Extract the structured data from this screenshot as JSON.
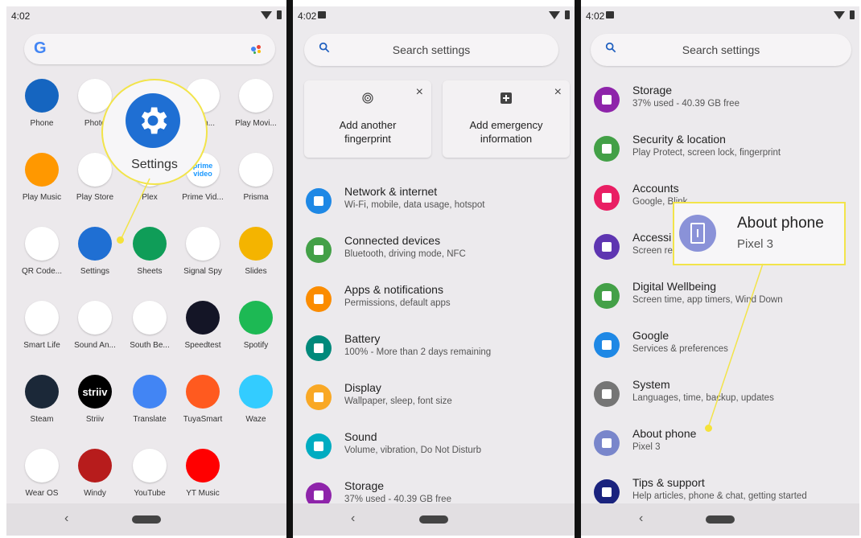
{
  "status": {
    "time": "4:02"
  },
  "launcher": {
    "apps": [
      {
        "label": "Phone",
        "color": "#1565c0"
      },
      {
        "label": "Photo",
        "color": "#ffffff"
      },
      {
        "label": "",
        "color": "#ffffff"
      },
      {
        "label": "Gam...",
        "color": "#ffffff"
      },
      {
        "label": "Play Movi...",
        "color": "#ffffff"
      },
      {
        "label": "Play Music",
        "color": "#ff9800"
      },
      {
        "label": "Play Store",
        "color": "#ffffff"
      },
      {
        "label": "Plex",
        "color": "#ffffff"
      },
      {
        "label": "Prime Vid...",
        "color": "#ffffff"
      },
      {
        "label": "Prisma",
        "color": "#ffffff"
      },
      {
        "label": "QR Code...",
        "color": "#ffffff"
      },
      {
        "label": "Settings",
        "color": "#1f6fd3"
      },
      {
        "label": "Sheets",
        "color": "#0f9d58"
      },
      {
        "label": "Signal Spy",
        "color": "#ffffff"
      },
      {
        "label": "Slides",
        "color": "#f4b400"
      },
      {
        "label": "Smart Life",
        "color": "#ffffff"
      },
      {
        "label": "Sound An...",
        "color": "#ffffff"
      },
      {
        "label": "South Be...",
        "color": "#ffffff"
      },
      {
        "label": "Speedtest",
        "color": "#141526"
      },
      {
        "label": "Spotify",
        "color": "#1db954"
      },
      {
        "label": "Steam",
        "color": "#1b2838"
      },
      {
        "label": "Striiv",
        "color": "#000000"
      },
      {
        "label": "Translate",
        "color": "#4285f4"
      },
      {
        "label": "TuyaSmart",
        "color": "#ff5a1f"
      },
      {
        "label": "Waze",
        "color": "#33ccff"
      },
      {
        "label": "Wear OS",
        "color": "#ffffff"
      },
      {
        "label": "Windy",
        "color": "#b71c1c"
      },
      {
        "label": "YouTube",
        "color": "#ffffff"
      },
      {
        "label": "YT Music",
        "color": "#ff0000"
      }
    ],
    "app_text": {
      "striiv": "striiv",
      "prime": "prime video"
    },
    "callout_label": "Settings"
  },
  "settings": {
    "search_placeholder": "Search settings",
    "suggestions": [
      {
        "title_line1": "Add another",
        "title_line2": "fingerprint",
        "icon": "fingerprint-icon"
      },
      {
        "title_line1": "Add emergency",
        "title_line2": "information",
        "icon": "plus-icon"
      }
    ],
    "rows": [
      {
        "title": "Network & internet",
        "subtitle": "Wi-Fi, mobile, data usage, hotspot",
        "color": "#1e88e5",
        "icon": "wifi-icon"
      },
      {
        "title": "Connected devices",
        "subtitle": "Bluetooth, driving mode, NFC",
        "color": "#43a047",
        "icon": "devices-icon"
      },
      {
        "title": "Apps & notifications",
        "subtitle": "Permissions, default apps",
        "color": "#fb8c00",
        "icon": "apps-icon"
      },
      {
        "title": "Battery",
        "subtitle": "100% - More than 2 days remaining",
        "color": "#00897b",
        "icon": "battery-icon"
      },
      {
        "title": "Display",
        "subtitle": "Wallpaper, sleep, font size",
        "color": "#f9a825",
        "icon": "display-icon"
      },
      {
        "title": "Sound",
        "subtitle": "Volume, vibration, Do Not Disturb",
        "color": "#00acc1",
        "icon": "sound-icon"
      },
      {
        "title": "Storage",
        "subtitle": "37% used - 40.39 GB free",
        "color": "#8e24aa",
        "icon": "storage-icon"
      }
    ]
  },
  "settings_scrolled": {
    "rows": [
      {
        "title": "Storage",
        "subtitle": "37% used - 40.39 GB free",
        "color": "#8e24aa",
        "icon": "storage-icon"
      },
      {
        "title": "Security & location",
        "subtitle": "Play Protect, screen lock, fingerprint",
        "color": "#43a047",
        "icon": "lock-icon"
      },
      {
        "title": "Accounts",
        "subtitle": "Google, Blink",
        "color": "#e91e63",
        "icon": "accounts-icon"
      },
      {
        "title": "Accessi",
        "subtitle": "Screen re",
        "color": "#5e35b1",
        "icon": "accessibility-icon"
      },
      {
        "title": "Digital Wellbeing",
        "subtitle": "Screen time, app timers, Wind Down",
        "color": "#43a047",
        "icon": "wellbeing-icon"
      },
      {
        "title": "Google",
        "subtitle": "Services & preferences",
        "color": "#1e88e5",
        "icon": "google-icon"
      },
      {
        "title": "System",
        "subtitle": "Languages, time, backup, updates",
        "color": "#757575",
        "icon": "info-icon"
      },
      {
        "title": "About phone",
        "subtitle": "Pixel 3",
        "color": "#7986cb",
        "icon": "phone-icon"
      },
      {
        "title": "Tips & support",
        "subtitle": "Help articles, phone & chat, getting started",
        "color": "#1a237e",
        "icon": "help-icon"
      }
    ],
    "callout": {
      "title": "About phone",
      "subtitle": "Pixel 3"
    }
  },
  "colors": {
    "highlight": "#f2e44a"
  }
}
